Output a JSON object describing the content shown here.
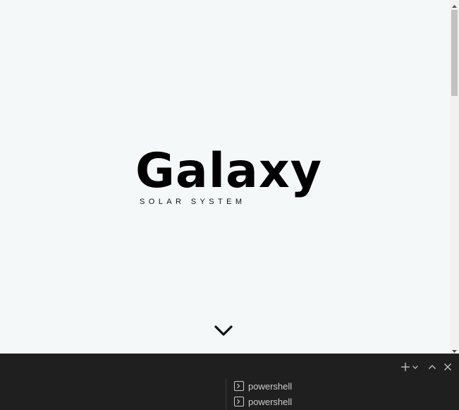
{
  "hero": {
    "title": "Galaxy",
    "subtitle": "SOLAR SYSTEM"
  },
  "icons": {
    "scroll_down": "chevron-down-icon",
    "new_terminal": "plus-icon",
    "terminal_dropdown": "chevron-down-icon",
    "maximize_panel": "chevron-up-icon",
    "close_panel": "close-icon",
    "terminal": "terminal-icon"
  },
  "terminal_panel": {
    "terminals": [
      {
        "label": "powershell"
      },
      {
        "label": "powershell"
      }
    ]
  },
  "colors": {
    "page_background": "#f5f8f9",
    "panel_background": "#1f1f1f",
    "panel_text": "#cccccc"
  }
}
